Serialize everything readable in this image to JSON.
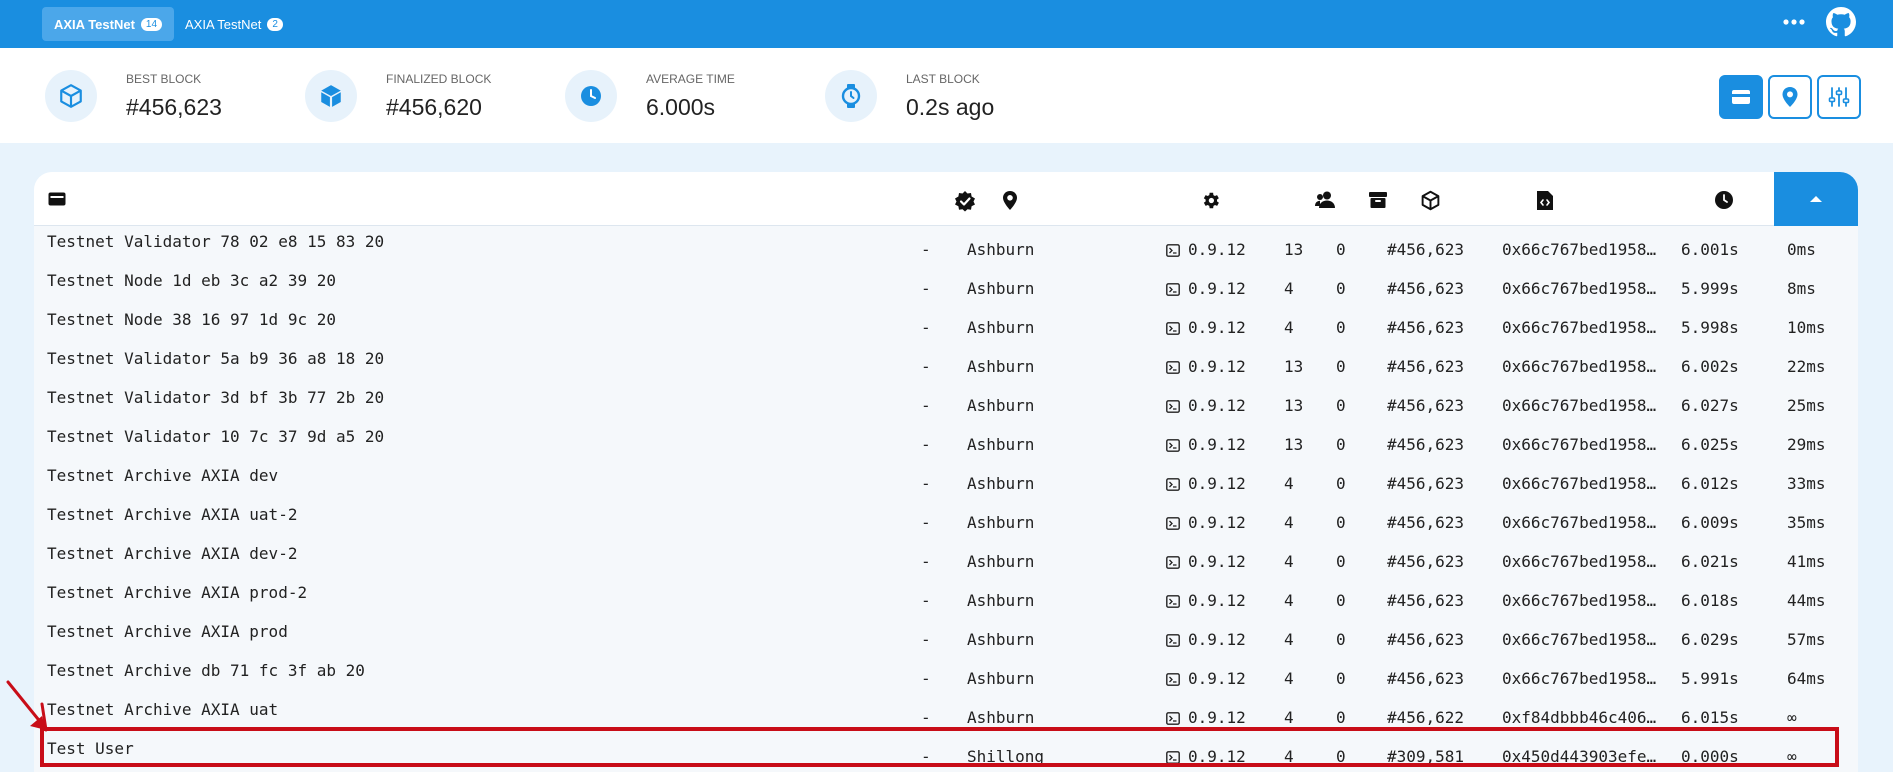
{
  "tabs": [
    {
      "label": "AXIA TestNet",
      "count": "14",
      "active": true
    },
    {
      "label": "AXIA TestNet",
      "count": "2",
      "active": false
    }
  ],
  "top_icons": {
    "menu": "more-dots-icon",
    "repo": "github-icon"
  },
  "stats": {
    "best_block": {
      "label": "BEST BLOCK",
      "value": "#456,623",
      "icon": "cube-outline-icon"
    },
    "finalized_block": {
      "label": "FINALIZED BLOCK",
      "value": "#456,620",
      "icon": "cube-solid-icon"
    },
    "average_time": {
      "label": "AVERAGE TIME",
      "value": "6.000s",
      "icon": "clock-icon"
    },
    "last_block": {
      "label": "LAST BLOCK",
      "value": "0.2s ago",
      "icon": "watch-icon"
    }
  },
  "view_buttons": [
    {
      "name": "list-view",
      "icon": "card-icon",
      "active": true
    },
    {
      "name": "map-view",
      "icon": "map-pin-icon",
      "active": false
    },
    {
      "name": "settings-view",
      "icon": "sliders-icon",
      "active": false
    }
  ],
  "columns": [
    "node-name-icon",
    "validator-check-icon",
    "location-icon",
    "implementation-gear-icon",
    "peers-icon",
    "transactions-archive-icon",
    "block-cube-icon",
    "block-hash-icon",
    "block-time-icon",
    "sort-up-icon"
  ],
  "rows": [
    {
      "name": "Testnet Validator 78 02 e8 15 83 20",
      "validator": "-",
      "location": "Ashburn",
      "version": "0.9.12",
      "peers": "13",
      "txs": "0",
      "block": "#456,623",
      "hash": "0x66c767bed1958…",
      "block_time": "6.001s",
      "propagation": "0ms"
    },
    {
      "name": "Testnet Node 1d eb 3c a2 39 20",
      "validator": "-",
      "location": "Ashburn",
      "version": "0.9.12",
      "peers": "4",
      "txs": "0",
      "block": "#456,623",
      "hash": "0x66c767bed1958…",
      "block_time": "5.999s",
      "propagation": "8ms"
    },
    {
      "name": "Testnet Node 38 16 97 1d 9c 20",
      "validator": "-",
      "location": "Ashburn",
      "version": "0.9.12",
      "peers": "4",
      "txs": "0",
      "block": "#456,623",
      "hash": "0x66c767bed1958…",
      "block_time": "5.998s",
      "propagation": "10ms"
    },
    {
      "name": "Testnet Validator 5a b9 36 a8 18 20",
      "validator": "-",
      "location": "Ashburn",
      "version": "0.9.12",
      "peers": "13",
      "txs": "0",
      "block": "#456,623",
      "hash": "0x66c767bed1958…",
      "block_time": "6.002s",
      "propagation": "22ms"
    },
    {
      "name": "Testnet Validator 3d bf 3b 77 2b 20",
      "validator": "-",
      "location": "Ashburn",
      "version": "0.9.12",
      "peers": "13",
      "txs": "0",
      "block": "#456,623",
      "hash": "0x66c767bed1958…",
      "block_time": "6.027s",
      "propagation": "25ms"
    },
    {
      "name": "Testnet Validator 10 7c 37 9d a5 20",
      "validator": "-",
      "location": "Ashburn",
      "version": "0.9.12",
      "peers": "13",
      "txs": "0",
      "block": "#456,623",
      "hash": "0x66c767bed1958…",
      "block_time": "6.025s",
      "propagation": "29ms"
    },
    {
      "name": "Testnet Archive AXIA dev",
      "validator": "-",
      "location": "Ashburn",
      "version": "0.9.12",
      "peers": "4",
      "txs": "0",
      "block": "#456,623",
      "hash": "0x66c767bed1958…",
      "block_time": "6.012s",
      "propagation": "33ms"
    },
    {
      "name": "Testnet Archive AXIA uat-2",
      "validator": "-",
      "location": "Ashburn",
      "version": "0.9.12",
      "peers": "4",
      "txs": "0",
      "block": "#456,623",
      "hash": "0x66c767bed1958…",
      "block_time": "6.009s",
      "propagation": "35ms"
    },
    {
      "name": "Testnet Archive AXIA dev-2",
      "validator": "-",
      "location": "Ashburn",
      "version": "0.9.12",
      "peers": "4",
      "txs": "0",
      "block": "#456,623",
      "hash": "0x66c767bed1958…",
      "block_time": "6.021s",
      "propagation": "41ms"
    },
    {
      "name": "Testnet Archive AXIA prod-2",
      "validator": "-",
      "location": "Ashburn",
      "version": "0.9.12",
      "peers": "4",
      "txs": "0",
      "block": "#456,623",
      "hash": "0x66c767bed1958…",
      "block_time": "6.018s",
      "propagation": "44ms"
    },
    {
      "name": "Testnet Archive AXIA prod",
      "validator": "-",
      "location": "Ashburn",
      "version": "0.9.12",
      "peers": "4",
      "txs": "0",
      "block": "#456,623",
      "hash": "0x66c767bed1958…",
      "block_time": "6.029s",
      "propagation": "57ms"
    },
    {
      "name": "Testnet Archive db 71 fc 3f ab 20",
      "validator": "-",
      "location": "Ashburn",
      "version": "0.9.12",
      "peers": "4",
      "txs": "0",
      "block": "#456,623",
      "hash": "0x66c767bed1958…",
      "block_time": "5.991s",
      "propagation": "64ms"
    },
    {
      "name": "Testnet Archive AXIA uat",
      "validator": "-",
      "location": "Ashburn",
      "version": "0.9.12",
      "peers": "4",
      "txs": "0",
      "block": "#456,622",
      "hash": "0xf84dbbb46c406…",
      "block_time": "6.015s",
      "propagation": "∞"
    },
    {
      "name": "Test User",
      "validator": "-",
      "location": "Shillong",
      "version": "0.9.12",
      "peers": "4",
      "txs": "0",
      "block": "#309,581",
      "hash": "0x450d443903efe…",
      "block_time": "0.000s",
      "propagation": "∞"
    }
  ],
  "colors": {
    "accent": "#1a8ee0",
    "highlight": "#c80d18",
    "background": "#e8f3fc"
  }
}
